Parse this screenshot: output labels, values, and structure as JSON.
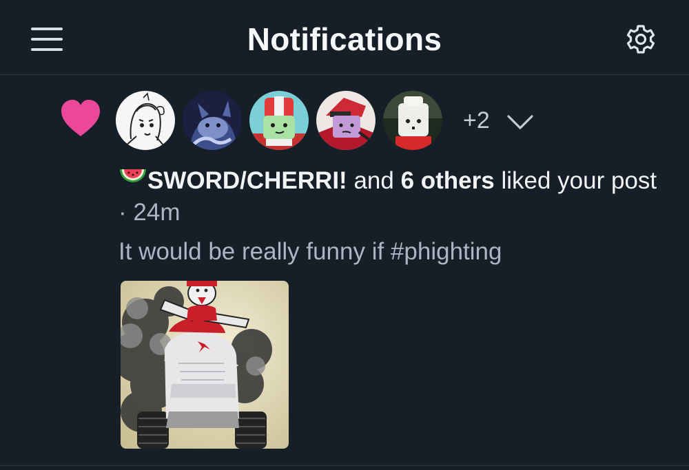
{
  "header": {
    "title": "Notifications",
    "menu_icon": "hamburger-menu-icon",
    "settings_icon": "gear-icon"
  },
  "notification": {
    "type_icon": "heart-icon",
    "type_color": "#ec4899",
    "avatar_overflow": "+2",
    "expand_icon": "chevron-down-icon",
    "actor_emoji": "watermelon",
    "actor_name": "SWORD/CHERRI!",
    "connector": " and ",
    "others": "6 others",
    "action": " liked your post",
    "separator": " · ",
    "time": "24m",
    "post_text": "It would be really funny if #phighting"
  },
  "colors": {
    "background": "#161e27",
    "divider": "#2e3945",
    "muted_text": "#aab6c2",
    "accent_like": "#ec4899"
  }
}
